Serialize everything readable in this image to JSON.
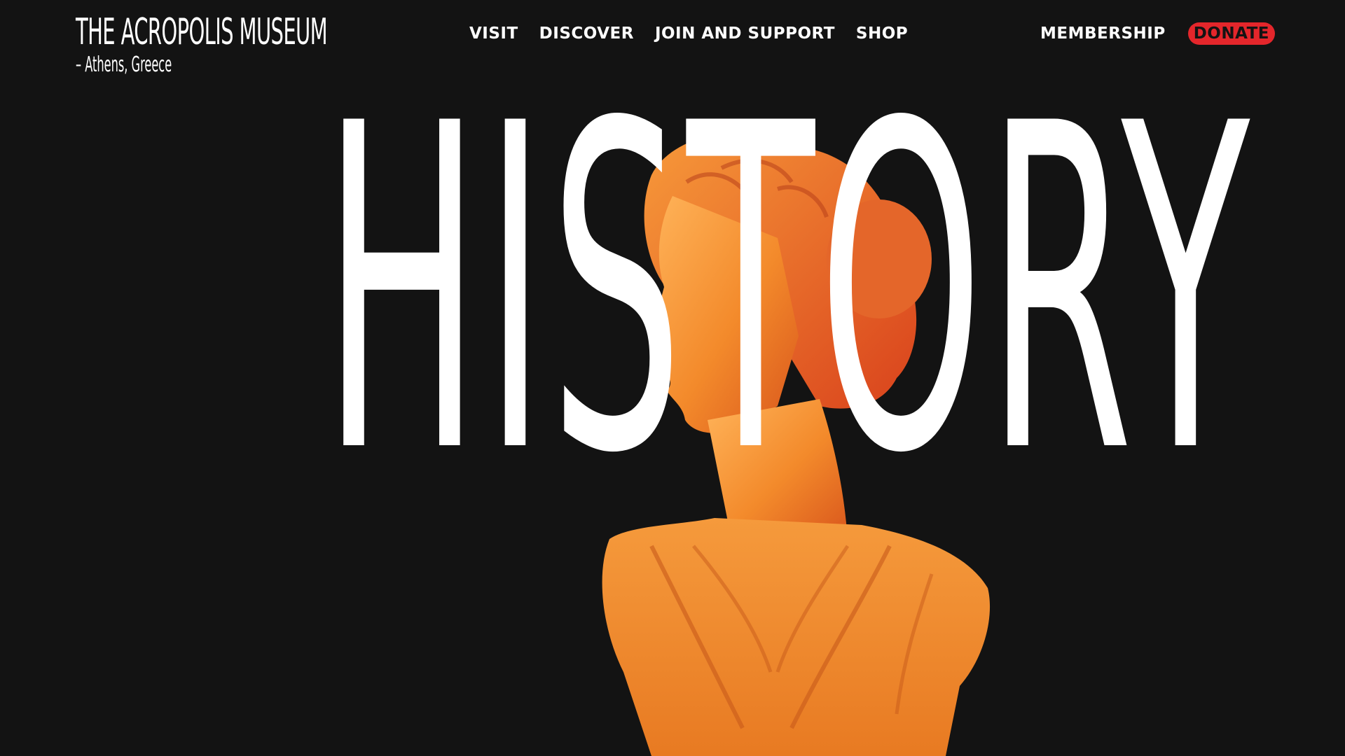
{
  "brand": {
    "title": "THE ACROPOLIS MUSEUM",
    "subtitle": "– Athens, Greece"
  },
  "nav": {
    "items": [
      {
        "label": "VISIT"
      },
      {
        "label": "DISCOVER"
      },
      {
        "label": "JOIN AND SUPPORT"
      },
      {
        "label": "SHOP"
      }
    ]
  },
  "utility": {
    "membership_label": "MEMBERSHIP",
    "donate_label": "DONATE"
  },
  "hero": {
    "headline": "HISTORY",
    "image": "statue-bust-orange"
  },
  "colors": {
    "background": "#131313",
    "accent": "#e4262b",
    "text": "#ffffff",
    "statue": "#f28b2c"
  }
}
